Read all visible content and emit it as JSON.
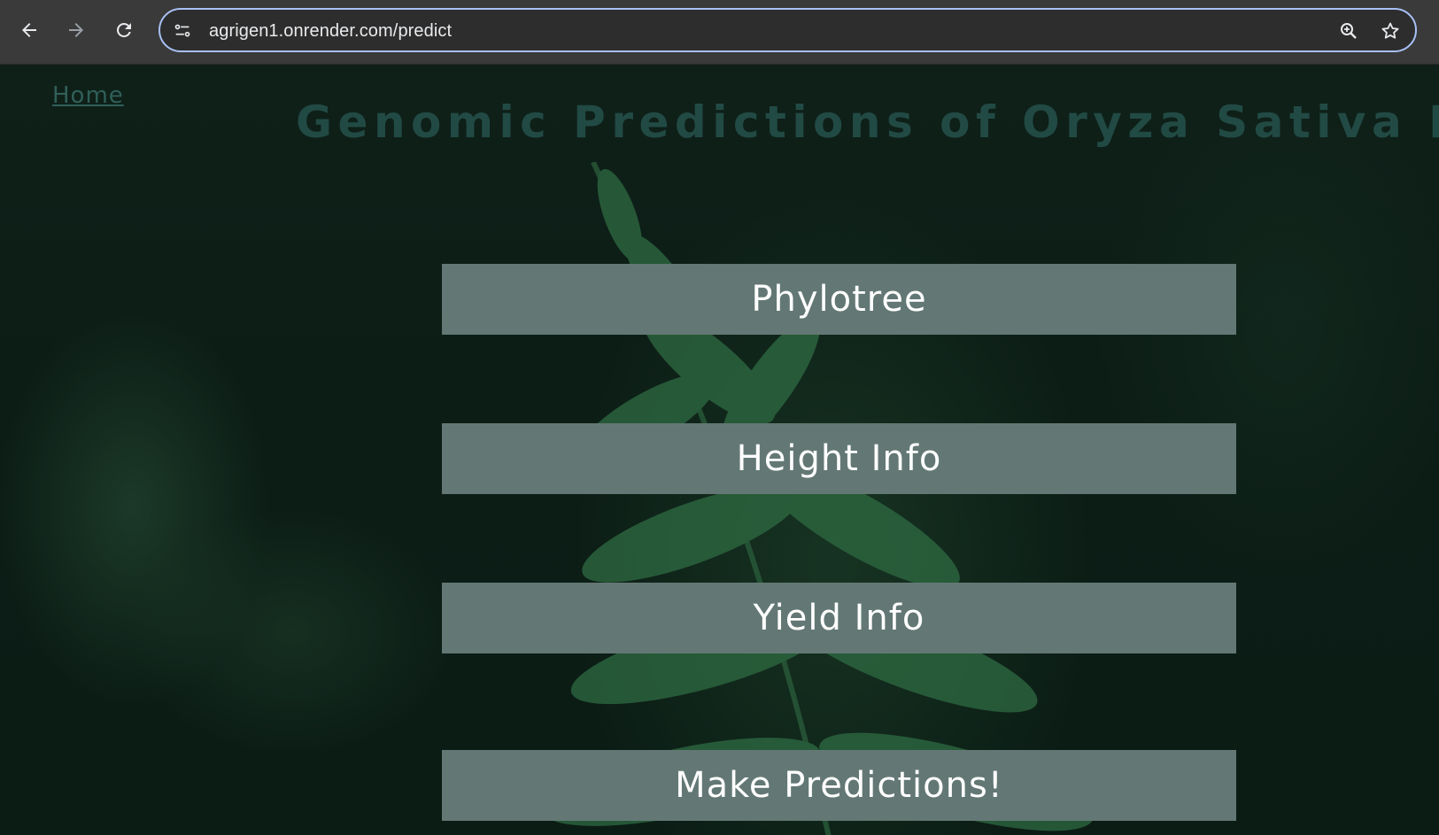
{
  "browser": {
    "url": "agrigen1.onrender.com/predict",
    "icons": [
      "back-arrow-icon",
      "forward-arrow-icon",
      "reload-icon",
      "site-info-icon",
      "zoom-icon",
      "bookmark-star-icon"
    ]
  },
  "page": {
    "home_link": "Home",
    "title": "Genomic Predictions of Oryza Sativa Plant",
    "buttons": [
      {
        "label": "Phylotree"
      },
      {
        "label": "Height Info"
      },
      {
        "label": "Yield Info"
      },
      {
        "label": "Make Predictions!"
      }
    ]
  },
  "colors": {
    "button_bg": "#637874",
    "button_text": "#ffffff",
    "title": "#224a44",
    "home_link": "#2f5f58",
    "omnibox_border": "#a8c0f5"
  }
}
